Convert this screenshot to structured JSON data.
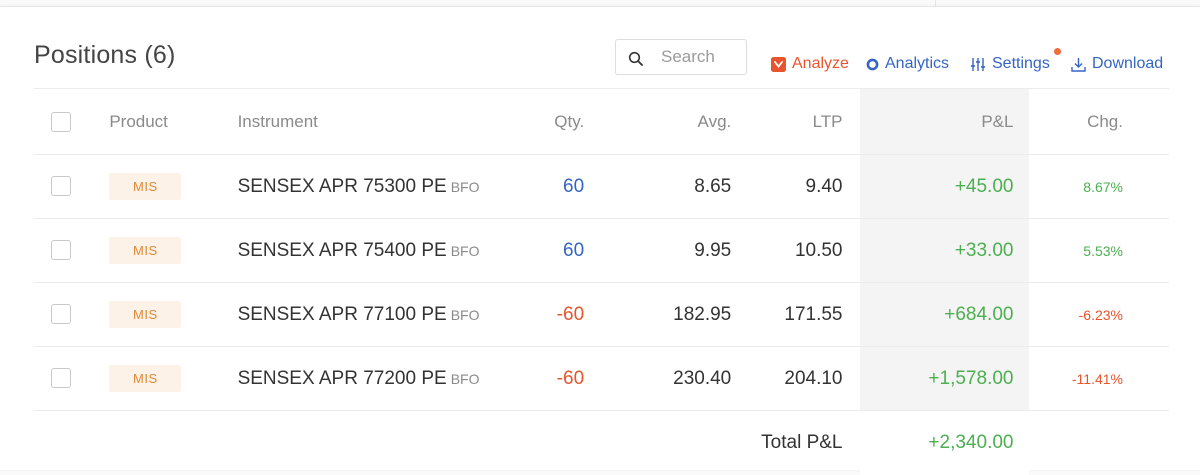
{
  "header": {
    "title": "Positions (6)",
    "search_placeholder": "Search",
    "tools": {
      "analyze": "Analyze",
      "analytics": "Analytics",
      "settings": "Settings",
      "download": "Download"
    }
  },
  "colors": {
    "accent_orange": "#e8542d",
    "link_blue": "#3565c4",
    "profit_green": "#4caf50",
    "badge_bg": "#fdf2e8",
    "badge_text": "#e08a3a"
  },
  "icons": [
    "search-icon",
    "analyze-icon",
    "analytics-icon",
    "settings-icon",
    "download-icon"
  ],
  "columns": {
    "product": "Product",
    "instrument": "Instrument",
    "qty": "Qty.",
    "avg": "Avg.",
    "ltp": "LTP",
    "pnl": "P&L",
    "chg": "Chg."
  },
  "rows": [
    {
      "product": "MIS",
      "instrument": "SENSEX APR 75300 PE",
      "exchange": "BFO",
      "qty": "60",
      "avg": "8.65",
      "ltp": "9.40",
      "pnl": "+45.00",
      "chg": "8.67%"
    },
    {
      "product": "MIS",
      "instrument": "SENSEX APR 75400 PE",
      "exchange": "BFO",
      "qty": "60",
      "avg": "9.95",
      "ltp": "10.50",
      "pnl": "+33.00",
      "chg": "5.53%"
    },
    {
      "product": "MIS",
      "instrument": "SENSEX APR 77100 PE",
      "exchange": "BFO",
      "qty": "-60",
      "avg": "182.95",
      "ltp": "171.55",
      "pnl": "+684.00",
      "chg": "-6.23%"
    },
    {
      "product": "MIS",
      "instrument": "SENSEX APR 77200 PE",
      "exchange": "BFO",
      "qty": "-60",
      "avg": "230.40",
      "ltp": "204.10",
      "pnl": "+1,578.00",
      "chg": "-11.41%"
    }
  ],
  "total": {
    "label": "Total P&L",
    "value": "+2,340.00"
  }
}
